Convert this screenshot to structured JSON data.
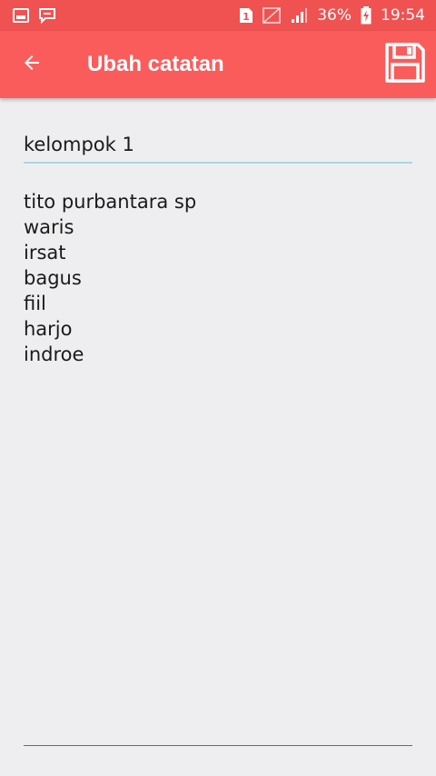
{
  "status_bar": {
    "icons_left": [
      "image-notification-icon",
      "message-notification-icon"
    ],
    "sim_badge": "1",
    "battery_percent": "36%",
    "time": "19:54",
    "colors": {
      "background": "#f05252",
      "foreground": "#ffffff"
    }
  },
  "toolbar": {
    "title": "Ubah catatan",
    "back_icon": "arrow-left-icon",
    "save_icon": "floppy-disk-icon",
    "colors": {
      "background": "#fa5c5c",
      "foreground": "#ffffff"
    }
  },
  "editor": {
    "title_value": "kelompok 1",
    "body_lines": [
      "tito purbantara sp",
      "waris",
      "irsat",
      "bagus",
      "fiil",
      "harjo",
      "indroe"
    ],
    "accent_color": "#a9d6e6"
  }
}
